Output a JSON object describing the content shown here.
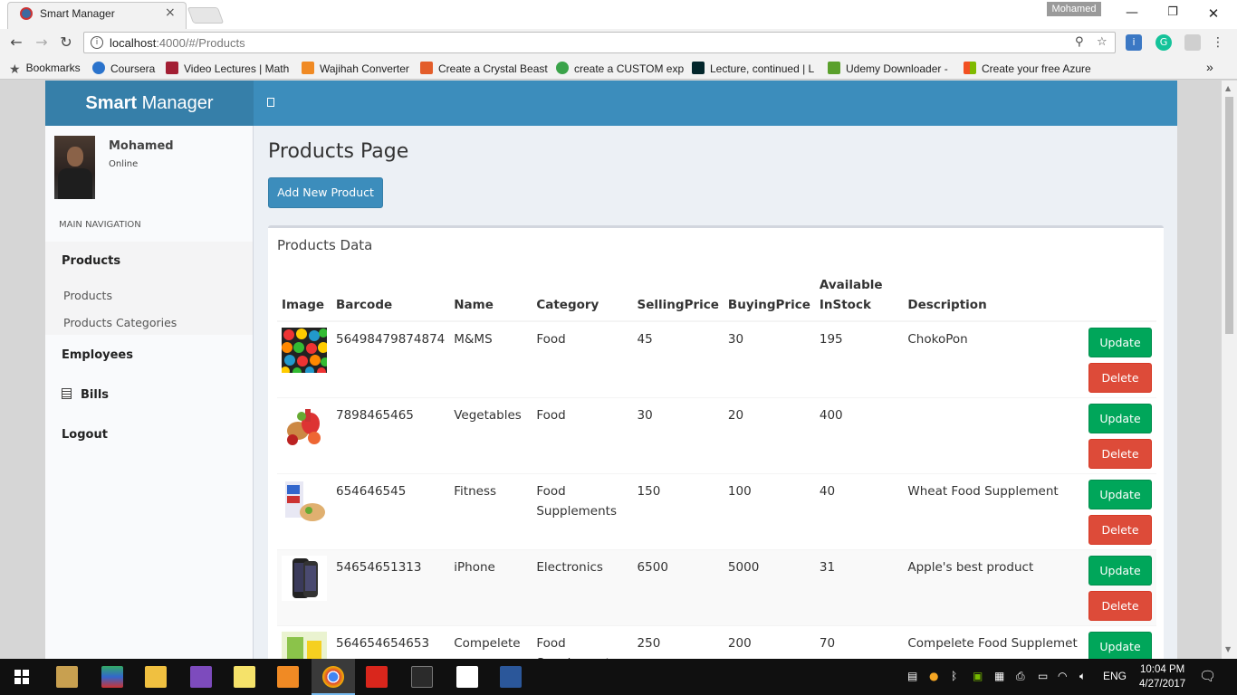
{
  "browser": {
    "tab_title": "Smart Manager",
    "tab_close": "×",
    "profile_name": "Mohamed",
    "url_host": "localhost",
    "url_path": ":4000/#/Products",
    "bookmarks": [
      {
        "label": "Bookmarks",
        "color": "#555555"
      },
      {
        "label": "Coursera",
        "color": "#2a73cc"
      },
      {
        "label": "Video Lectures | Math",
        "color": "#a31f34"
      },
      {
        "label": "Wajihah Converter",
        "color": "#f08a24"
      },
      {
        "label": "Create a Crystal Beast",
        "color": "#e35d2a"
      },
      {
        "label": "create a CUSTOM exp",
        "color": "#3aa34a"
      },
      {
        "label": "Lecture, continued | L",
        "color": "#02262b"
      },
      {
        "label": "Udemy Downloader -",
        "color": "#5aa02c"
      },
      {
        "label": "Create your free Azure",
        "color": "#f25022"
      }
    ],
    "overflow": "»"
  },
  "app": {
    "logo_bold": "Smart",
    "logo_rest": " Manager",
    "header_color": "#3c8dbc"
  },
  "sidebar": {
    "user_name": "Mohamed",
    "user_status": "Online",
    "nav_header": "MAIN NAVIGATION",
    "items": [
      {
        "label": "Products"
      },
      {
        "label": "Products"
      },
      {
        "label": "Products Categories"
      },
      {
        "label": "Employees"
      },
      {
        "label": "Bills"
      },
      {
        "label": "Logout"
      }
    ]
  },
  "content": {
    "page_title": "Products Page",
    "add_button": "Add New Product",
    "box_title": "Products Data",
    "columns": [
      "Image",
      "Barcode",
      "Name",
      "Category",
      "SellingPrice",
      "BuyingPrice",
      "Available InStock",
      "Description",
      ""
    ],
    "update_label": "Update",
    "delete_label": "Delete",
    "rows": [
      {
        "barcode": "56498479874874",
        "name": "M&MS",
        "category": "Food",
        "selling": "45",
        "buying": "30",
        "stock": "195",
        "description": "ChokoPon"
      },
      {
        "barcode": "7898465465",
        "name": "Vegetables",
        "category": "Food",
        "selling": "30",
        "buying": "20",
        "stock": "400",
        "description": ""
      },
      {
        "barcode": "654646545",
        "name": "Fitness",
        "category": "Food Supplements",
        "selling": "150",
        "buying": "100",
        "stock": "40",
        "description": "Wheat Food Supplement"
      },
      {
        "barcode": "54654651313",
        "name": "iPhone",
        "category": "Electronics",
        "selling": "6500",
        "buying": "5000",
        "stock": "31",
        "description": "Apple's best product"
      },
      {
        "barcode": "564654654653",
        "name": "Compelete",
        "category": "Food Supplements",
        "selling": "250",
        "buying": "200",
        "stock": "70",
        "description": "Compelete Food Supplemet"
      }
    ]
  },
  "taskbar": {
    "lang": "ENG",
    "time": "10:04 PM",
    "date": "4/27/2017"
  }
}
